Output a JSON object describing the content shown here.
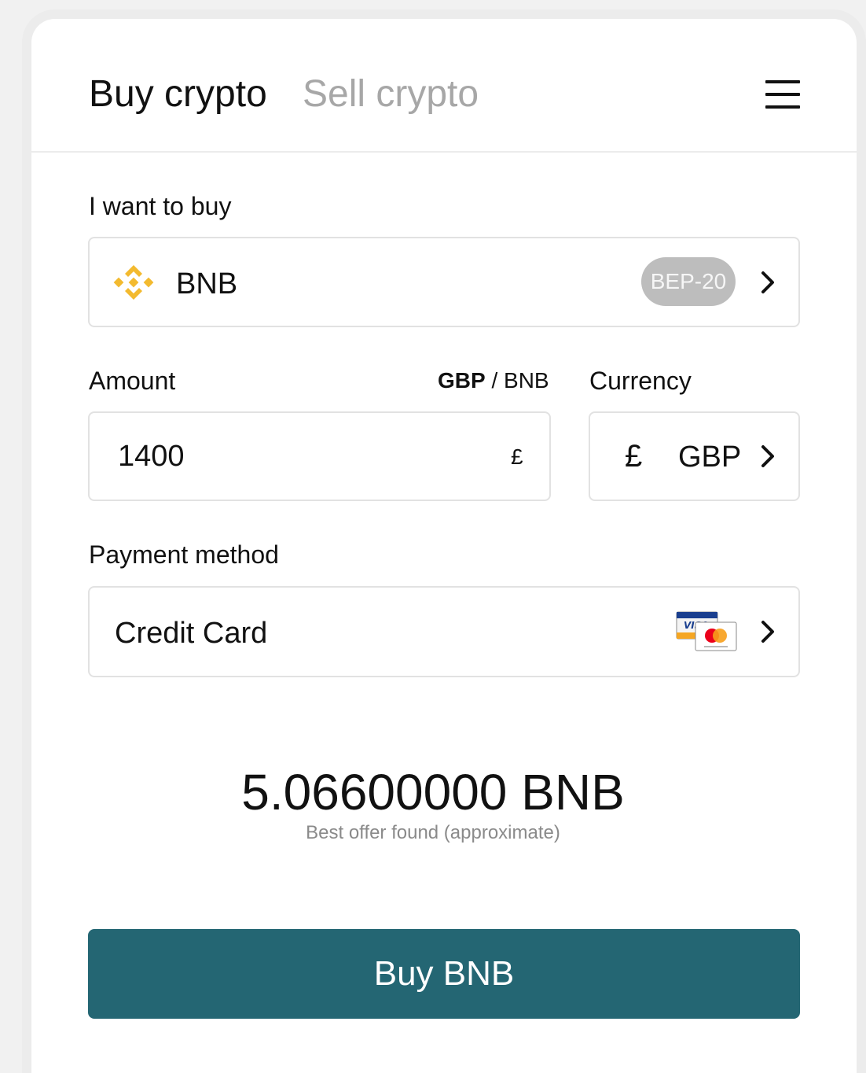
{
  "tabs": {
    "buy_label": "Buy crypto",
    "sell_label": "Sell crypto"
  },
  "buy_section": {
    "label": "I want to buy",
    "coin": "BNB",
    "network": "BEP-20"
  },
  "amount": {
    "label": "Amount",
    "toggle_primary": "GBP",
    "toggle_separator": " / ",
    "toggle_secondary": "BNB",
    "value": "1400",
    "suffix": "£"
  },
  "currency": {
    "label": "Currency",
    "symbol": "£",
    "code": "GBP"
  },
  "payment": {
    "label": "Payment method",
    "method": "Credit Card"
  },
  "result": {
    "amount": "5.06600000 BNB",
    "caption": "Best offer found (approximate)"
  },
  "cta": {
    "label": "Buy BNB"
  },
  "colors": {
    "primary": "#246673",
    "bnb_yellow": "#F3BA2F",
    "badge_bg": "#BDBDBD",
    "inactive_tab": "#A7A7A7"
  },
  "icons": {
    "menu": "hamburger-menu-icon",
    "coin": "bnb-logo-icon",
    "chevron": "chevron-right-icon",
    "cards": "visa-mastercard-icon"
  }
}
